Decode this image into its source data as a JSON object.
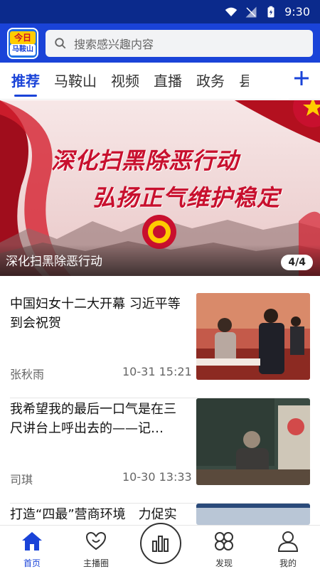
{
  "status_bar": {
    "time": "9:30"
  },
  "header": {
    "logo_top": "今日",
    "logo_bottom": "马鞍山",
    "search_placeholder": "搜索感兴趣内容"
  },
  "tabs": [
    {
      "label": "推荐",
      "active": true
    },
    {
      "label": "马鞍山"
    },
    {
      "label": "视频"
    },
    {
      "label": "直播"
    },
    {
      "label": "政务"
    },
    {
      "label": "县"
    }
  ],
  "banner": {
    "line1": "深化扫黑除恶行动",
    "line2": "弘扬正气维护稳定",
    "caption": "深化扫黑除恶行动",
    "pager": "4/4"
  },
  "news": [
    {
      "title": "中国妇女十二大开幕 习近平等到会祝贺",
      "source": "张秋雨",
      "time": "10-31 15:21"
    },
    {
      "title": "我希望我的最后一口气是在三尺讲台上呼出去的——记…",
      "source": "司琪",
      "time": "10-30 13:33"
    },
    {
      "title": "打造“四最”营商环境　力促实体经济发展",
      "source": "",
      "time": ""
    }
  ],
  "bottom_nav": [
    {
      "label": "首页",
      "icon": "home-icon",
      "active": true
    },
    {
      "label": "主播圈",
      "icon": "hearts-icon"
    },
    {
      "label": "",
      "icon": "bars-icon"
    },
    {
      "label": "发现",
      "icon": "discover-icon"
    },
    {
      "label": "我的",
      "icon": "user-icon"
    }
  ],
  "colors": {
    "brand": "#1a43d8",
    "status_bar": "#0b2a8c",
    "banner_red": "#c8102e"
  }
}
